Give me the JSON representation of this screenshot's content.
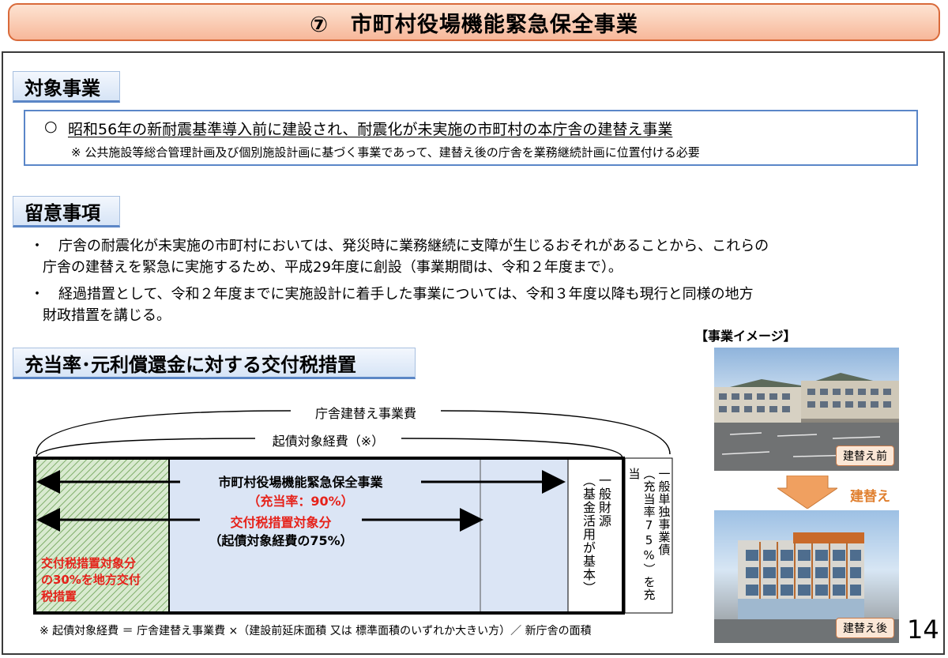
{
  "title": "⑦　市町村役場機能緊急保全事業",
  "target_section": {
    "heading": "対象事業",
    "bullet": "○",
    "main_text": "昭和56年の新耐震基準導入前に建設され、耐震化が未実施の市町村の本庁舎の建替え事業",
    "note": "※ 公共施設等総合管理計画及び個別施設計画に基づく事業であって、建替え後の庁舎を業務継続計画に位置付ける必要"
  },
  "notes_section": {
    "heading": "留意事項",
    "items": [
      {
        "bullet": "・",
        "line1": "庁舎の耐震化が未実施の市町村においては、発災時に業務継続に支障が生じるおそれがあることから、これらの",
        "line2": "庁舎の建替えを緊急に実施するため、平成29年度に創設（事業期間は、令和２年度まで）。"
      },
      {
        "bullet": "・",
        "line1": "経過措置として、令和２年度までに実施設計に着手した事業については、令和３年度以降も現行と同様の地方",
        "line2": "財政措置を講じる。"
      }
    ]
  },
  "grant_section": {
    "heading": "充当率･元利償還金に対する交付税措置",
    "diagram": {
      "total_label": "庁舎建替え事業費",
      "eligible_label": "起債対象経費（※）",
      "project_name": "市町村役場機能緊急保全事業",
      "allocation_rate": "（充当率：90%）",
      "grant_target": "交付税措置対象分",
      "grant_target_ratio": "（起債対象経費の75%）",
      "local_grant_line1": "交付税措置対象分",
      "local_grant_line2": "の30%を地方交付",
      "local_grant_line3": "税措置",
      "general_fund_main": "一般財源",
      "general_fund_sub": "（基金活用が基本）",
      "single_bond_main": "一般単独事業債",
      "single_bond_sub": "（充当率75%）を充当"
    },
    "footnote": "※ 起債対象経費 ＝ 庁舎建替え事業費 ×（建設前延床面積 又は 標準面積のいずれか大きい方）／ 新庁舎の面積"
  },
  "image_panel": {
    "caption": "【事業イメージ】",
    "before_label": "建替え前",
    "arrow_label": "建替え",
    "after_label": "建替え後"
  },
  "page_number": "14",
  "colors": {
    "accent_blue": "#5b86c6",
    "banner_orange": "#d96a3a",
    "red_text": "#e6221a",
    "diagram_fill": "#dbe5f5",
    "arrow_orange": "#f0a060"
  }
}
